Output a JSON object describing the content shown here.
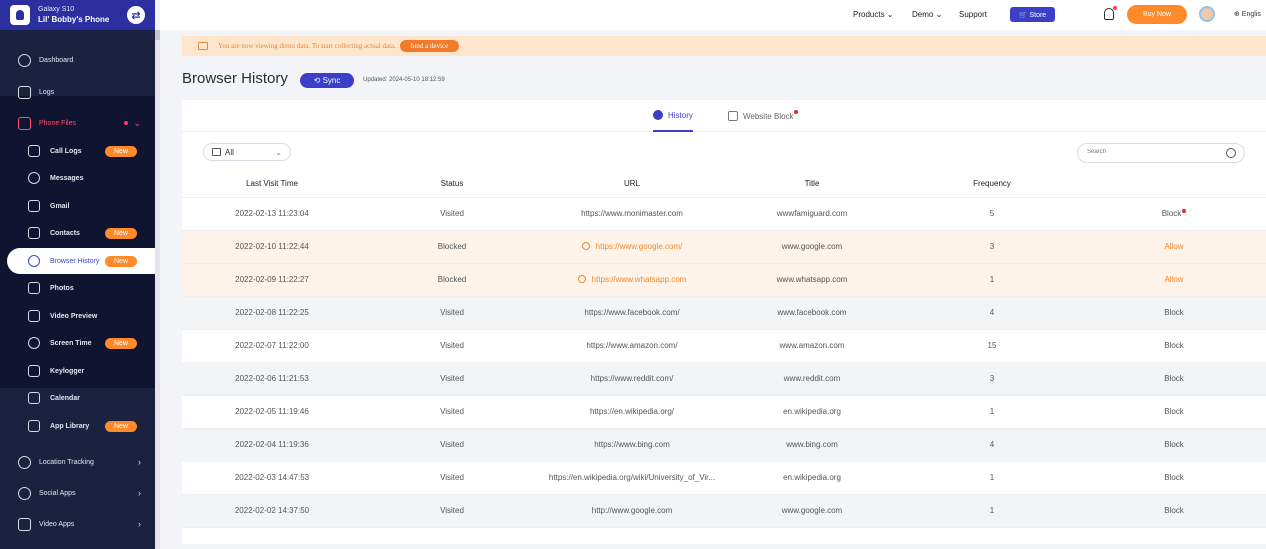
{
  "device": {
    "model": "Galaxy S10",
    "owner": "Lil' Bobby's Phone"
  },
  "topnav": {
    "products": "Products ⌄",
    "demo": "Demo ⌄",
    "support": "Support",
    "store": "🛒 Store",
    "buy": "Buy Now",
    "lang": "⊕ Englis"
  },
  "sidebar": {
    "dashboard": "Dashboard",
    "logs": "Logs",
    "phone_files": "Phone Files",
    "sub": [
      {
        "label": "Call Logs",
        "badge": "New"
      },
      {
        "label": "Messages",
        "badge": ""
      },
      {
        "label": "Gmail",
        "badge": ""
      },
      {
        "label": "Contacts",
        "badge": "New"
      },
      {
        "label": "Browser History",
        "badge": "New"
      },
      {
        "label": "Photos",
        "badge": ""
      },
      {
        "label": "Video Preview",
        "badge": ""
      },
      {
        "label": "Screen Time",
        "badge": "New"
      },
      {
        "label": "Keylogger",
        "badge": ""
      },
      {
        "label": "Calendar",
        "badge": ""
      },
      {
        "label": "App Library",
        "badge": "New"
      }
    ],
    "location": "Location Tracking",
    "social": "Social Apps",
    "video": "Video Apps"
  },
  "banner": {
    "text": "You are now viewing demo data. To start collecting actual data,",
    "button": "bind a device"
  },
  "page": {
    "title": "Browser History",
    "sync": "⟲ Sync",
    "updated": "Updated: 2024-05-10 18:12:59"
  },
  "tabs": {
    "history": "History",
    "website_block": "Website Block"
  },
  "filter": {
    "value": "All"
  },
  "search": {
    "placeholder": "Search"
  },
  "table": {
    "headers": [
      "Last Visit Time",
      "Status",
      "URL",
      "Title",
      "Frequency",
      ""
    ],
    "rows": [
      {
        "time": "2022-02-13 11:23:04",
        "status": "Visited",
        "url": "https://www.monimaster.com",
        "title": "wwwfamiguard.com",
        "freq": "5",
        "action": "Block"
      },
      {
        "time": "2022-02-10 11:22:44",
        "status": "Blocked",
        "url": "https://www.google.com/",
        "title": "www.google.com",
        "freq": "3",
        "action": "Allow"
      },
      {
        "time": "2022-02-09 11:22:27",
        "status": "Blocked",
        "url": "https://www.whatsapp.com",
        "title": "www.whatsapp.com",
        "freq": "1",
        "action": "Allow"
      },
      {
        "time": "2022-02-08 11:22:25",
        "status": "Visited",
        "url": "https://www.facebook.com/",
        "title": "www.facebook.com",
        "freq": "4",
        "action": "Block"
      },
      {
        "time": "2022-02-07 11:22:00",
        "status": "Visited",
        "url": "https://www.amazon.com/",
        "title": "www.amazon.com",
        "freq": "15",
        "action": "Block"
      },
      {
        "time": "2022-02-06 11:21:53",
        "status": "Visited",
        "url": "https://www.reddit.com/",
        "title": "www.reddit.com",
        "freq": "3",
        "action": "Block"
      },
      {
        "time": "2022-02-05 11:19:46",
        "status": "Visited",
        "url": "https://en.wikipedia.org/",
        "title": "en.wikipedia.org",
        "freq": "1",
        "action": "Block"
      },
      {
        "time": "2022-02-04 11:19:36",
        "status": "Visited",
        "url": "https://www.bing.com",
        "title": "www.bing.com",
        "freq": "4",
        "action": "Block"
      },
      {
        "time": "2022-02-03 14:47:53",
        "status": "Visited",
        "url": "https://en.wikipedia.org/wiki/University_of_Vir...",
        "title": "en.wikipedia.org",
        "freq": "1",
        "action": "Block"
      },
      {
        "time": "2022-02-02 14:37:50",
        "status": "Visited",
        "url": "http://www.google.com",
        "title": "www.google.com",
        "freq": "1",
        "action": "Block"
      }
    ]
  }
}
